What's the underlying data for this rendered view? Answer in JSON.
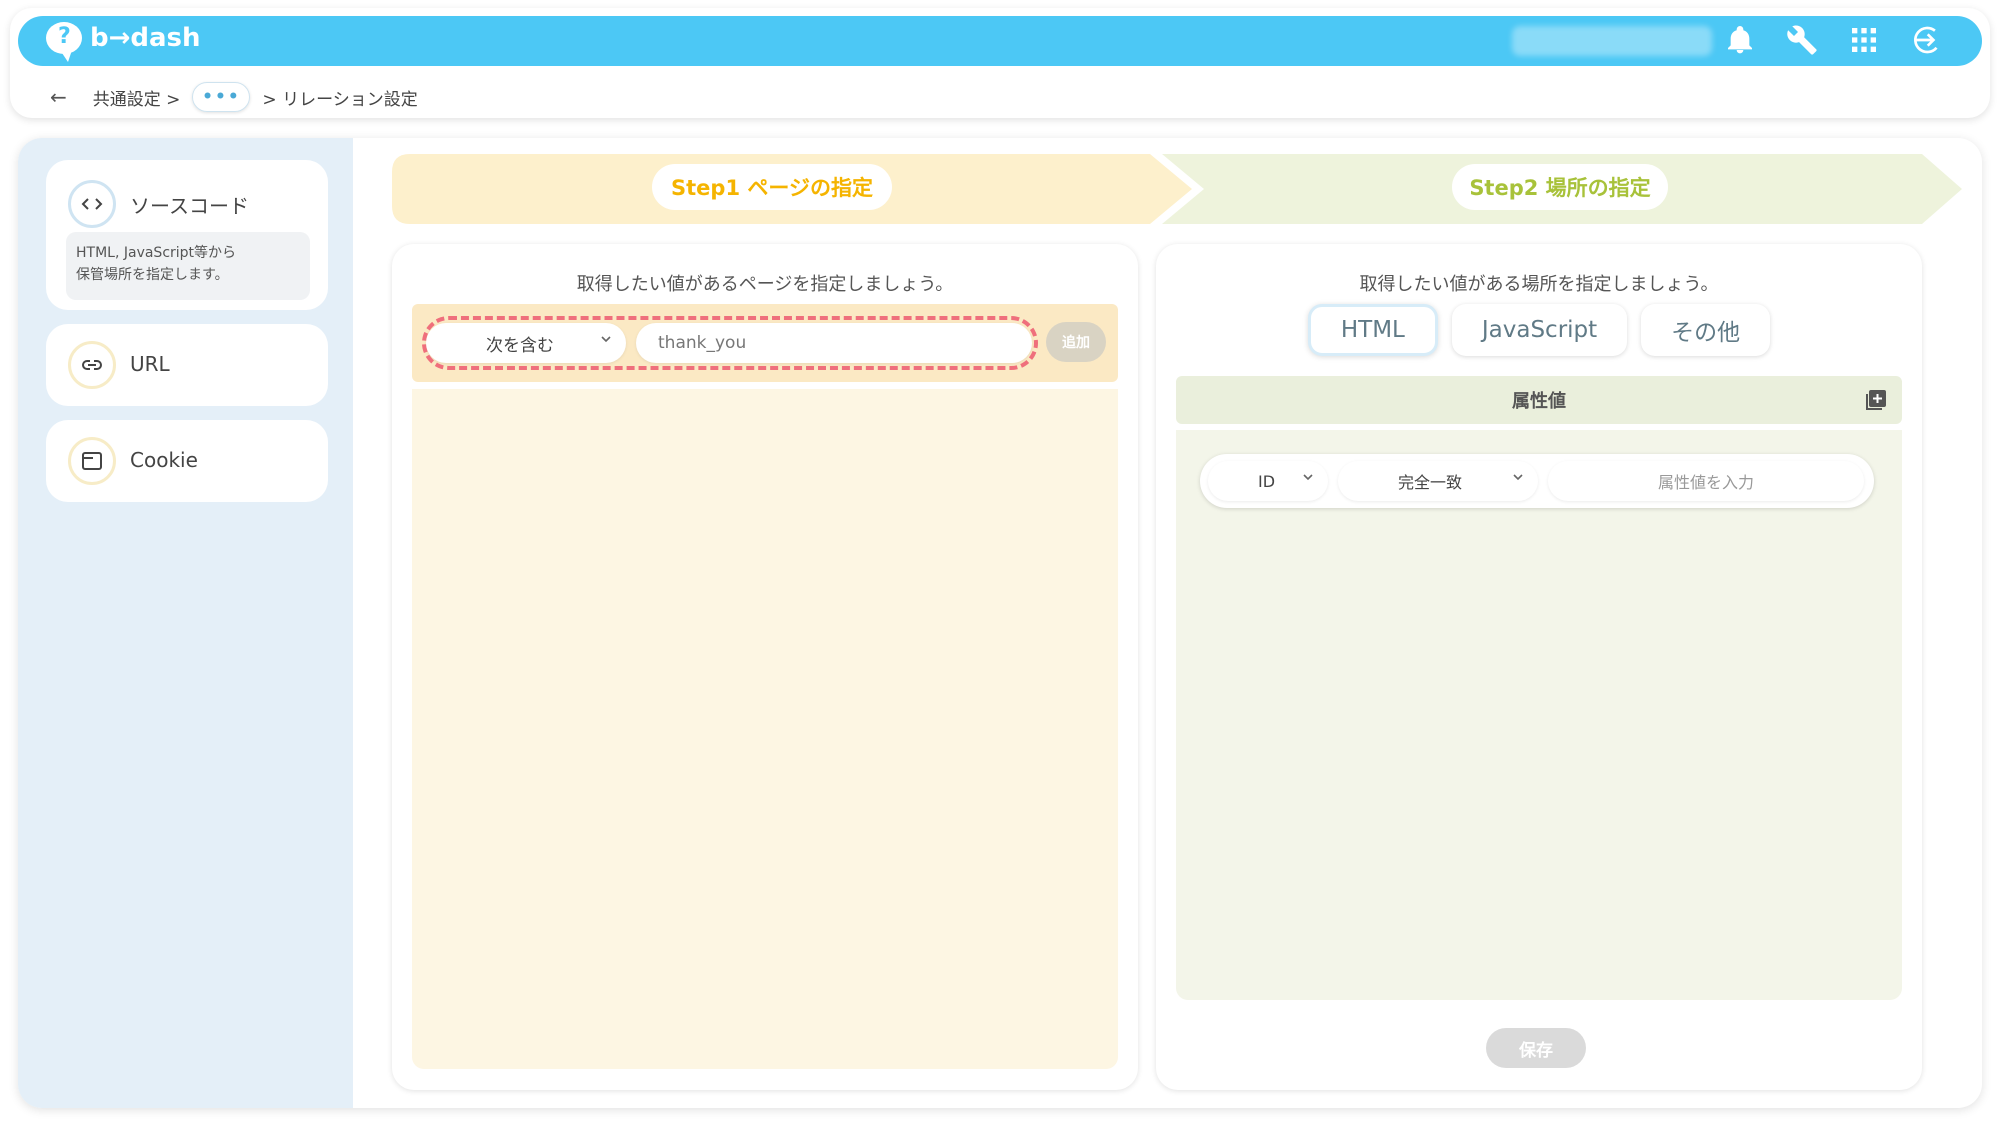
{
  "app": {
    "logo_text": "b→dash"
  },
  "breadcrumb": {
    "back": "←",
    "item1": "共通設定 >",
    "ellipsis": "•••",
    "current": "> リレーション設定"
  },
  "sidebar": {
    "items": [
      {
        "label": "ソースコード",
        "description_line1": "HTML, JavaScript等から",
        "description_line2": "保管場所を指定します。"
      },
      {
        "label": "URL"
      },
      {
        "label": "Cookie"
      }
    ]
  },
  "steps": {
    "step1": {
      "label": "Step1 ページの指定",
      "color": "#f5b400"
    },
    "step2": {
      "label": "Step2 場所の指定",
      "color": "#a8c23a"
    }
  },
  "step1": {
    "instruction": "取得したい値があるページを指定しましょう。",
    "match_select": "次を含む",
    "url_value": "thank_you",
    "add_button": "追加"
  },
  "step2": {
    "instruction": "取得したい値がある場所を指定しましょう。",
    "tabs": [
      "HTML",
      "JavaScript",
      "その他"
    ],
    "section_title": "属性値",
    "attr_type_select": "ID",
    "match_select": "完全一致",
    "attr_placeholder": "属性値を入力",
    "save_button": "保存"
  },
  "colors": {
    "topbar": "#4cc8f5",
    "dash_highlight": "#ef6f7c"
  }
}
